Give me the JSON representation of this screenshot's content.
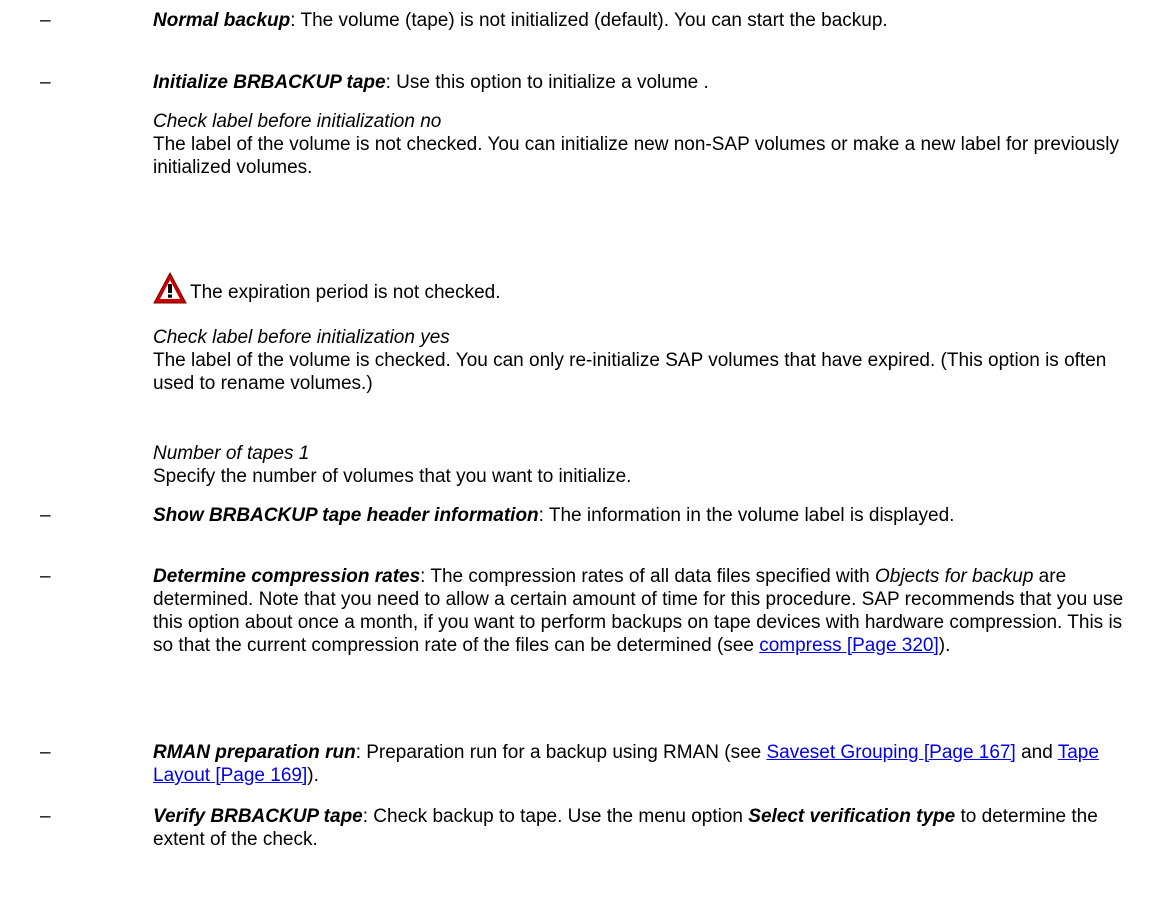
{
  "dash": "–",
  "items": {
    "normal": {
      "term": "Normal backup",
      "text": ": The volume (tape) is not initialized (default). You can start the backup."
    },
    "initialize": {
      "term": "Initialize BRBACKUP tape",
      "text": ": Use this option to initialize a volume ."
    },
    "show_header": {
      "term": "Show BRBACKUP tape header information",
      "text": ": The information in the volume label is displayed."
    },
    "compression": {
      "term": "Determine compression rates",
      "text1": ": The compression rates of all data files specified with ",
      "objects": "Objects for backup",
      "text2": " are determined. Note that you need to allow a certain amount of time for this procedure. SAP recommends that you use this option about once a month, if you want to perform backups on tape devices with hardware compression. This is so that the current compression rate of the files can be determined (see ",
      "link": "compress [Page 320]",
      "text3": ")."
    },
    "rman": {
      "term": "RMAN preparation run",
      "text1": ": Preparation run for a backup using RMAN (see ",
      "link1": "Saveset Grouping [Page 167]",
      "text2": " and ",
      "link2": "Tape Layout [Page 169]",
      "text3": ")."
    },
    "verify": {
      "term": "Verify BRBACKUP tape",
      "text1": ": Check backup to tape. Use the menu option ",
      "term2": "Select verification type",
      "text2": " to determine the extent of the check."
    }
  },
  "sub": {
    "check_no": {
      "title": "Check label before initialization no",
      "text": "The label of the volume is not checked. You can initialize new non-SAP volumes or make a new label for previously initialized volumes."
    },
    "warning": "The expiration period is not checked.",
    "check_yes": {
      "title": "Check label before initialization yes",
      "text": "The label of the volume is checked. You can only re-initialize SAP volumes that have expired. (This option is often used to rename volumes.)"
    },
    "tapes": {
      "title": "Number of tapes 1",
      "text": "Specify the number of volumes that you want to initialize."
    }
  },
  "colors": {
    "link": "#0000ee",
    "warning_red": "#cc0000"
  },
  "icons": {
    "warning": "warning-triangle-icon"
  }
}
